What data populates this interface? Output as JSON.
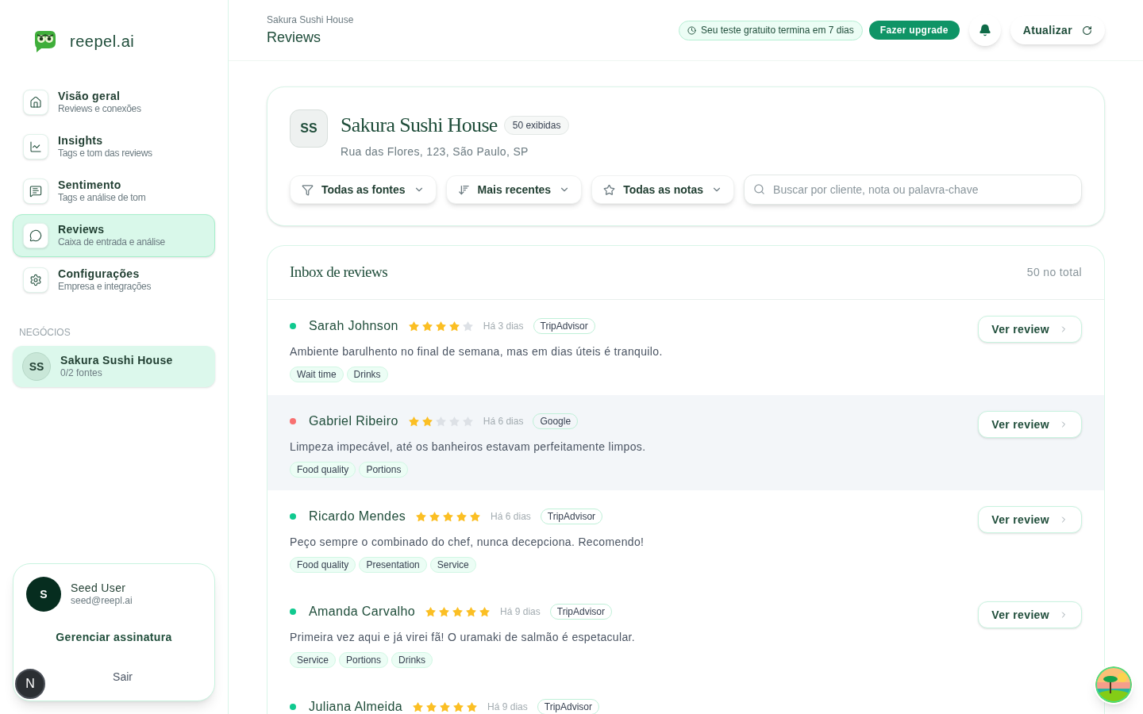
{
  "brand": {
    "name": "reepel.ai"
  },
  "nav": [
    {
      "kind": "home",
      "title": "Visão geral",
      "subtitle": "Reviews e conexões",
      "selected": false
    },
    {
      "kind": "chart",
      "title": "Insights",
      "subtitle": "Tags e tom das reviews",
      "selected": false
    },
    {
      "kind": "comment",
      "title": "Sentimento",
      "subtitle": "Tags e análise de tom",
      "selected": false
    },
    {
      "kind": "chat",
      "title": "Reviews",
      "subtitle": "Caixa de entrada e análise",
      "selected": true
    },
    {
      "kind": "gear",
      "title": "Configurações",
      "subtitle": "Empresa e integrações",
      "selected": false
    }
  ],
  "businesses": {
    "heading": "NEGÓCIOS",
    "items": [
      {
        "initials": "SS",
        "name": "Sakura Sushi House",
        "sources": "0/2 fontes",
        "selected": true
      }
    ]
  },
  "user": {
    "initial": "S",
    "name": "Seed User",
    "email": "seed@reepl.ai",
    "manage": "Gerenciar assinatura",
    "logout": "Sair"
  },
  "dev_badge": "N",
  "header": {
    "breadcrumb": "Sakura Sushi House",
    "title": "Reviews",
    "trial": "Seu teste gratuito termina em 7 dias",
    "upgrade": "Fazer upgrade",
    "refresh": "Atualizar"
  },
  "business_card": {
    "initials": "SS",
    "name": "Sakura Sushi House",
    "count": "50 exibidas",
    "address": "Rua das Flores, 123, São Paulo, SP",
    "filters": [
      {
        "kind": "filter",
        "label": "Todas as fontes"
      },
      {
        "kind": "sort",
        "label": "Mais recentes"
      },
      {
        "kind": "star",
        "label": "Todas as notas"
      }
    ],
    "search": {
      "placeholder": "Buscar por cliente, nota ou palavra-chave"
    }
  },
  "inbox": {
    "title": "Inbox de reviews",
    "total": "50 no total",
    "reviews": [
      {
        "name": "Sarah Johnson",
        "color": "#10c98f",
        "stars": 4,
        "time": "Há 3 dias",
        "source": "TripAdvisor",
        "text": "Ambiente barulhento no final de semana, mas em dias úteis é tranquilo.",
        "tags": [
          "Wait time",
          "Drinks"
        ],
        "button": "Ver review",
        "selected": false
      },
      {
        "name": "Gabriel Ribeiro",
        "color": "#f87171",
        "stars": 2,
        "time": "Há 6 dias",
        "source": "Google",
        "text": "Limpeza impecável, até os banheiros estavam perfeitamente limpos.",
        "tags": [
          "Food quality",
          "Portions"
        ],
        "button": "Ver review",
        "selected": true
      },
      {
        "name": "Ricardo Mendes",
        "color": "#10c98f",
        "stars": 5,
        "time": "Há 6 dias",
        "source": "TripAdvisor",
        "text": "Peço sempre o combinado do chef, nunca decepciona. Recomendo!",
        "tags": [
          "Food quality",
          "Presentation",
          "Service"
        ],
        "button": "Ver review",
        "selected": false
      },
      {
        "name": "Amanda Carvalho",
        "color": "#10c98f",
        "stars": 5,
        "time": "Há 9 dias",
        "source": "TripAdvisor",
        "text": "Primeira vez aqui e já virei fã! O uramaki de salmão é espetacular.",
        "tags": [
          "Service",
          "Portions",
          "Drinks"
        ],
        "button": "Ver review",
        "selected": false
      },
      {
        "name": "Juliana Almeida",
        "color": "#10c98f",
        "stars": 5,
        "time": "Há 9 dias",
        "source": "TripAdvisor",
        "selected": false
      }
    ]
  }
}
